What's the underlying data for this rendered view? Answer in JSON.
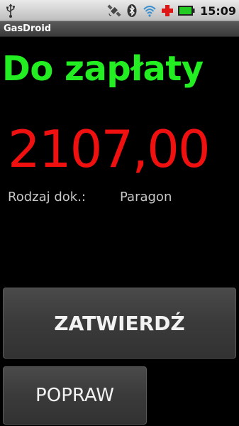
{
  "status_bar": {
    "time": "15:09",
    "icons": [
      "usb-icon",
      "gps-icon",
      "bluetooth-icon",
      "wifi-icon",
      "red-cross-icon",
      "battery-icon"
    ],
    "battery_color": "#22cc22"
  },
  "app": {
    "title": "GasDroid"
  },
  "payment": {
    "heading": "Do zapłaty",
    "amount": "2107,00",
    "doc_type_label": "Rodzaj dok.:",
    "doc_type_value": "Paragon"
  },
  "buttons": {
    "confirm_label": "ZATWIERDŹ",
    "fix_label": "POPRAW"
  },
  "colors": {
    "heading": "#22ee22",
    "amount": "#f01010",
    "background": "#000000"
  }
}
